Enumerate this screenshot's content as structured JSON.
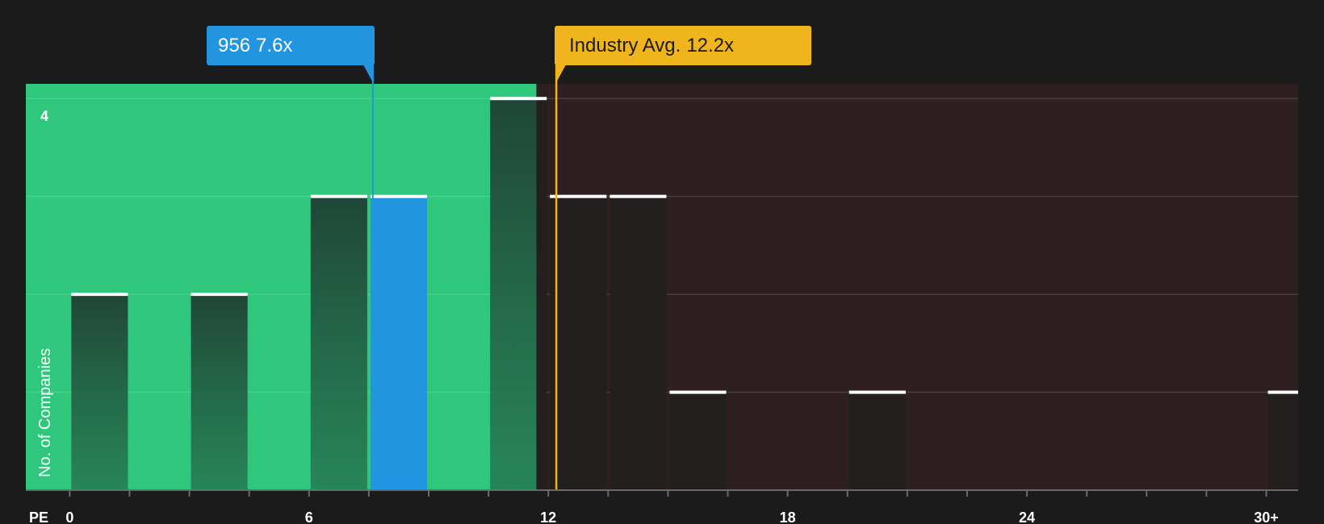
{
  "chart_data": {
    "type": "bar",
    "x_axis_label": "PE",
    "y_axis_label": "No. of Companies",
    "y_tick_labels": [
      "4"
    ],
    "x_tick_labels": [
      "0",
      "6",
      "12",
      "18",
      "24",
      "30+"
    ],
    "x_ticks": [
      0,
      6,
      12,
      18,
      24,
      30
    ],
    "xlim": [
      -1.1,
      30.8
    ],
    "ylim": [
      0,
      4.15
    ],
    "bin_width": 1.5,
    "bars": [
      {
        "x_start": 0,
        "count": 2,
        "highlight": false
      },
      {
        "x_start": 3,
        "count": 2,
        "highlight": false
      },
      {
        "x_start": 6,
        "count": 3,
        "highlight": false
      },
      {
        "x_start": 7.5,
        "count": 3,
        "highlight": true
      },
      {
        "x_start": 10.5,
        "count": 4,
        "highlight": false
      },
      {
        "x_start": 12,
        "count": 3,
        "highlight": false
      },
      {
        "x_start": 13.5,
        "count": 3,
        "highlight": false
      },
      {
        "x_start": 15,
        "count": 1,
        "highlight": false
      },
      {
        "x_start": 19.5,
        "count": 1,
        "highlight": false
      },
      {
        "x_start": 30,
        "count": 1,
        "highlight": false
      }
    ],
    "company": {
      "name": "956",
      "pe": 7.6,
      "label": "7.6x"
    },
    "industry_avg": {
      "name": "Industry Avg.",
      "pe": 12.2,
      "label": "12.2x"
    },
    "fair_region_end": 11.7,
    "colors": {
      "background": "#1b1b1b",
      "good_region": "#2ec77c",
      "bad_region": "#2e1f20",
      "bar_in_good": "#21493a",
      "bar_in_bad": "#231f1f",
      "highlight_bar": "#2394e0",
      "industry": "#f0b41c",
      "bar_cap": "#ffffff"
    }
  }
}
